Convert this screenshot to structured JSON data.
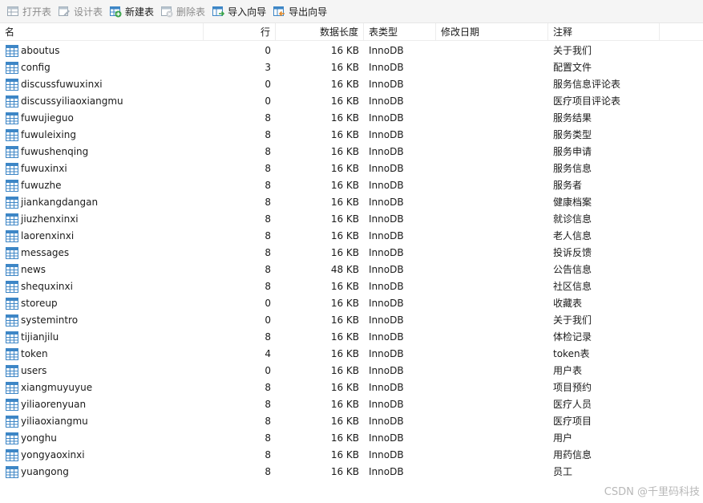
{
  "toolbar": {
    "open_label": "打开表",
    "design_label": "设计表",
    "new_label": "新建表",
    "delete_label": "删除表",
    "import_label": "导入向导",
    "export_label": "导出向导"
  },
  "columns": {
    "name": "名",
    "rows": "行",
    "data_length": "数据长度",
    "engine": "表类型",
    "modified": "修改日期",
    "comment": "注释"
  },
  "tables": [
    {
      "name": "aboutus",
      "rows": "0",
      "size": "16 KB",
      "engine": "InnoDB",
      "modified": "",
      "comment": "关于我们"
    },
    {
      "name": "config",
      "rows": "3",
      "size": "16 KB",
      "engine": "InnoDB",
      "modified": "",
      "comment": "配置文件"
    },
    {
      "name": "discussfuwuxinxi",
      "rows": "0",
      "size": "16 KB",
      "engine": "InnoDB",
      "modified": "",
      "comment": "服务信息评论表"
    },
    {
      "name": "discussyiliaoxiangmu",
      "rows": "0",
      "size": "16 KB",
      "engine": "InnoDB",
      "modified": "",
      "comment": "医疗项目评论表"
    },
    {
      "name": "fuwujieguo",
      "rows": "8",
      "size": "16 KB",
      "engine": "InnoDB",
      "modified": "",
      "comment": "服务结果"
    },
    {
      "name": "fuwuleixing",
      "rows": "8",
      "size": "16 KB",
      "engine": "InnoDB",
      "modified": "",
      "comment": "服务类型"
    },
    {
      "name": "fuwushenqing",
      "rows": "8",
      "size": "16 KB",
      "engine": "InnoDB",
      "modified": "",
      "comment": "服务申请"
    },
    {
      "name": "fuwuxinxi",
      "rows": "8",
      "size": "16 KB",
      "engine": "InnoDB",
      "modified": "",
      "comment": "服务信息"
    },
    {
      "name": "fuwuzhe",
      "rows": "8",
      "size": "16 KB",
      "engine": "InnoDB",
      "modified": "",
      "comment": "服务者"
    },
    {
      "name": "jiankangdangan",
      "rows": "8",
      "size": "16 KB",
      "engine": "InnoDB",
      "modified": "",
      "comment": "健康档案"
    },
    {
      "name": "jiuzhenxinxi",
      "rows": "8",
      "size": "16 KB",
      "engine": "InnoDB",
      "modified": "",
      "comment": "就诊信息"
    },
    {
      "name": "laorenxinxi",
      "rows": "8",
      "size": "16 KB",
      "engine": "InnoDB",
      "modified": "",
      "comment": "老人信息"
    },
    {
      "name": "messages",
      "rows": "8",
      "size": "16 KB",
      "engine": "InnoDB",
      "modified": "",
      "comment": "投诉反馈"
    },
    {
      "name": "news",
      "rows": "8",
      "size": "48 KB",
      "engine": "InnoDB",
      "modified": "",
      "comment": "公告信息"
    },
    {
      "name": "shequxinxi",
      "rows": "8",
      "size": "16 KB",
      "engine": "InnoDB",
      "modified": "",
      "comment": "社区信息"
    },
    {
      "name": "storeup",
      "rows": "0",
      "size": "16 KB",
      "engine": "InnoDB",
      "modified": "",
      "comment": "收藏表"
    },
    {
      "name": "systemintro",
      "rows": "0",
      "size": "16 KB",
      "engine": "InnoDB",
      "modified": "",
      "comment": "关于我们"
    },
    {
      "name": "tijianjilu",
      "rows": "8",
      "size": "16 KB",
      "engine": "InnoDB",
      "modified": "",
      "comment": "体检记录"
    },
    {
      "name": "token",
      "rows": "4",
      "size": "16 KB",
      "engine": "InnoDB",
      "modified": "",
      "comment": "token表"
    },
    {
      "name": "users",
      "rows": "0",
      "size": "16 KB",
      "engine": "InnoDB",
      "modified": "",
      "comment": "用户表"
    },
    {
      "name": "xiangmuyuyue",
      "rows": "8",
      "size": "16 KB",
      "engine": "InnoDB",
      "modified": "",
      "comment": "项目预约"
    },
    {
      "name": "yiliaorenyuan",
      "rows": "8",
      "size": "16 KB",
      "engine": "InnoDB",
      "modified": "",
      "comment": "医疗人员"
    },
    {
      "name": "yiliaoxiangmu",
      "rows": "8",
      "size": "16 KB",
      "engine": "InnoDB",
      "modified": "",
      "comment": "医疗项目"
    },
    {
      "name": "yonghu",
      "rows": "8",
      "size": "16 KB",
      "engine": "InnoDB",
      "modified": "",
      "comment": "用户"
    },
    {
      "name": "yongyaoxinxi",
      "rows": "8",
      "size": "16 KB",
      "engine": "InnoDB",
      "modified": "",
      "comment": "用药信息"
    },
    {
      "name": "yuangong",
      "rows": "8",
      "size": "16 KB",
      "engine": "InnoDB",
      "modified": "",
      "comment": "员工"
    }
  ],
  "icons": {
    "open": "table-open-icon",
    "design": "table-design-icon",
    "new": "table-new-icon",
    "delete": "table-delete-icon",
    "import": "import-wizard-icon",
    "export": "export-wizard-icon",
    "table": "table-icon"
  },
  "colors": {
    "table_icon": "#3d86c6",
    "new_plus": "#3aa34a",
    "delete_x": "#d04a4a"
  },
  "watermark": "CSDN @千里码科技"
}
